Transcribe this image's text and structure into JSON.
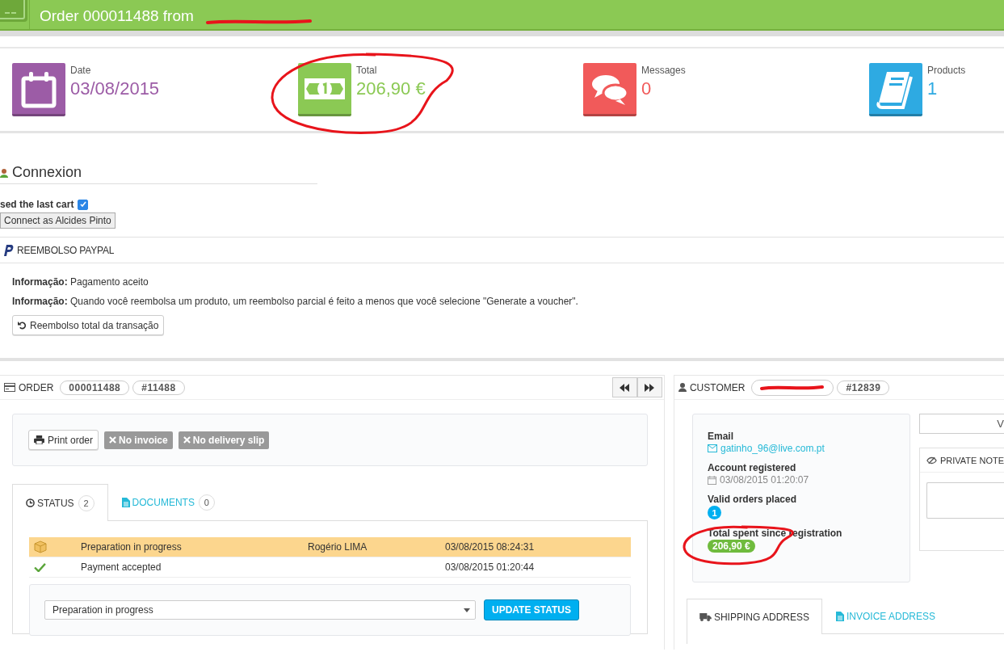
{
  "header": {
    "title": "Order 000011488 from",
    "name_redacted": true
  },
  "kpis": [
    {
      "kind": "date",
      "label": "Date",
      "value": "03/08/2015",
      "color": "#9c5ca6",
      "circled": false
    },
    {
      "kind": "money",
      "label": "Total",
      "value": "206,90 €",
      "color": "#8bc954",
      "circled": true
    },
    {
      "kind": "messages",
      "label": "Messages",
      "value": "0",
      "color": "#f15a5a",
      "circled": false
    },
    {
      "kind": "products",
      "label": "Products",
      "value": "1",
      "color": "#2eaae2",
      "circled": false
    }
  ],
  "connexion": {
    "title": "Connexion",
    "cart_label": "sed the last cart",
    "cart_checked": true,
    "button": "Connect as Alcides Pinto"
  },
  "paypal": {
    "title": "REEMBOLSO PAYPAL",
    "lines": [
      "**Informação:** Pagamento aceito",
      "**Informação:** Quando você reembolsa um produto, um reembolso parcial é feito a menos que você selecione \"Generate a voucher\"."
    ],
    "button": "Reembolso total da transação"
  },
  "order": {
    "title": "ORDER",
    "badges": [
      "000011488",
      "#11488"
    ],
    "actions": [
      {
        "kind": "print",
        "label": "Print order"
      },
      {
        "kind": "missing",
        "label": "No invoice"
      },
      {
        "kind": "missing",
        "label": "No delivery slip"
      }
    ],
    "tabs": [
      {
        "kind": "status",
        "label": "STATUS",
        "count": "2",
        "selected": true
      },
      {
        "kind": "documents",
        "label": "DOCUMENTS",
        "count": "0",
        "selected": false
      }
    ],
    "history": [
      {
        "kind": "box",
        "status": "Preparation in progress",
        "employee": "Rogério LIMA",
        "date": "03/08/2015 08:24:31",
        "current": true
      },
      {
        "kind": "check",
        "status": "Payment accepted",
        "date": "03/08/2015 01:20:44",
        "current": false
      }
    ],
    "status_select": "Preparation in progress",
    "update_button": "UPDATE STATUS"
  },
  "customer": {
    "title": "CUSTOMER",
    "name_redacted": true,
    "badge": "#12839",
    "stats": [
      {
        "kind": "email",
        "label": "Email",
        "value": "gatinho_96@live.com.pt",
        "circled": false
      },
      {
        "kind": "date",
        "label": "Account registered",
        "value": "03/08/2015 01:20:07",
        "circled": false
      },
      {
        "kind": "count",
        "label": "Valid orders placed",
        "value": "1",
        "circled": false
      },
      {
        "kind": "money",
        "label": "Total spent since registration",
        "value": "206,90 €",
        "circled": true
      }
    ],
    "view_button": "V",
    "private_note_title": "PRIVATE NOTE",
    "tabs": [
      {
        "kind": "shipping",
        "label": "SHIPPING ADDRESS",
        "selected": true
      },
      {
        "kind": "invoice",
        "label": "INVOICE ADDRESS",
        "selected": false
      }
    ]
  }
}
